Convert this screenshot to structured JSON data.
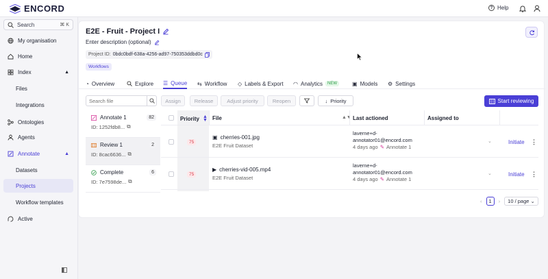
{
  "app": {
    "brand": "ENCORD",
    "accent": "#4a3fd6"
  },
  "topbar": {
    "help_label": "Help",
    "icons": [
      "help-icon",
      "bell-icon",
      "user-icon"
    ]
  },
  "sidebar": {
    "search_label": "Search",
    "search_shortcut": "⌘ K",
    "items": [
      {
        "label": "My organisation",
        "icon": "globe-icon"
      },
      {
        "label": "Home",
        "icon": "home-icon"
      },
      {
        "label": "Index",
        "icon": "index-icon",
        "expanded": true
      },
      {
        "label": "Files"
      },
      {
        "label": "Integrations"
      },
      {
        "label": "Ontologies",
        "icon": "ontology-icon"
      },
      {
        "label": "Agents",
        "icon": "agent-icon"
      },
      {
        "label": "Annotate",
        "icon": "annotate-icon",
        "expanded": true,
        "active": true
      },
      {
        "label": "Datasets"
      },
      {
        "label": "Projects",
        "selected": true
      },
      {
        "label": "Workflow templates"
      },
      {
        "label": "Active",
        "icon": "active-icon"
      }
    ]
  },
  "project": {
    "title": "E2E - Fruit - Project I",
    "description_placeholder": "Enter description (optional)",
    "id_label": "Project ID:",
    "id_value": "0bdc0bdf-638a-4256-ad97-750353ddbd0c",
    "badge": "Workflows"
  },
  "tabs": [
    {
      "label": "Overview"
    },
    {
      "label": "Explore"
    },
    {
      "label": "Queue",
      "active": true
    },
    {
      "label": "Workflow"
    },
    {
      "label": "Labels & Export"
    },
    {
      "label": "Analytics",
      "badge": "NEW"
    },
    {
      "label": "Models"
    },
    {
      "label": "Settings"
    }
  ],
  "queue": {
    "search_placeholder": "Search file",
    "buttons": {
      "assign": "Assign",
      "release": "Release",
      "adjust_priority": "Adjust priority",
      "reopen": "Reopen",
      "priority": "Priority",
      "start_reviewing": "Start reviewing"
    },
    "stages": [
      {
        "name": "Annotate 1",
        "id": "ID: 1252fdb8...",
        "count": "82",
        "color": "#d63a9a"
      },
      {
        "name": "Review 1",
        "id": "ID: 8cac6636...",
        "count": "2",
        "color": "#e07b2a",
        "selected": true
      },
      {
        "name": "Complete",
        "id": "ID: 7e7598de...",
        "count": "6",
        "color": "#2c9a46"
      }
    ],
    "columns": {
      "priority": "Priority",
      "file": "File",
      "last_actioned": "Last actioned",
      "assigned_to": "Assigned to"
    },
    "rows": [
      {
        "priority": "75",
        "file": "cherries-001.jpg",
        "file_type": "image",
        "dataset": "E2E Fruit Dataset",
        "user_line1": "laverne+d-",
        "user_line2": "annotator01@encord.com",
        "time": "4 days ago",
        "stage": "Annotate 1",
        "action": "Initiate"
      },
      {
        "priority": "75",
        "file": "cherries-vid-005.mp4",
        "file_type": "video",
        "dataset": "E2E Fruit Dataset",
        "user_line1": "laverne+d-",
        "user_line2": "annotator01@encord.com",
        "time": "4 days ago",
        "stage": "Annotate 1",
        "action": "Initiate"
      }
    ],
    "pagination": {
      "page": "1",
      "page_size": "10 / page"
    }
  }
}
